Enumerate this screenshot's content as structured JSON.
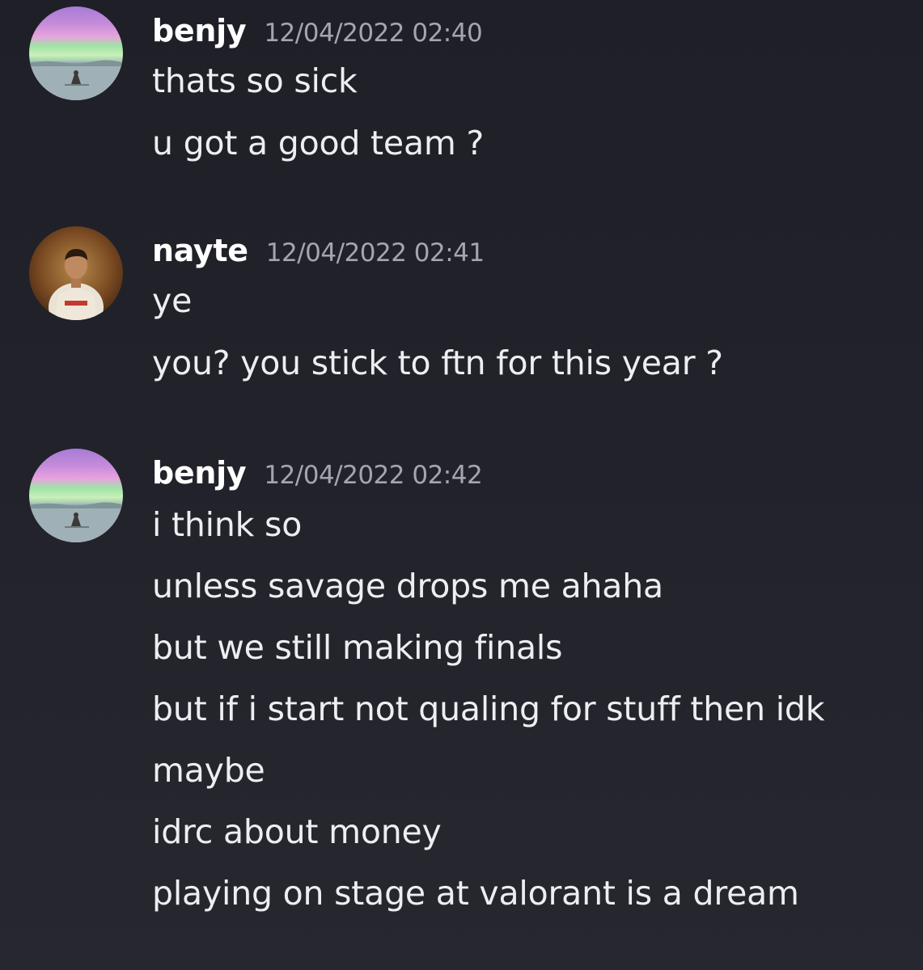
{
  "messages": [
    {
      "username": "benjy",
      "timestamp": "12/04/2022 02:40",
      "avatar_icon": "sunset-sea-avatar-icon",
      "lines": [
        "thats so sick",
        "u got a good team ?"
      ]
    },
    {
      "username": "nayte",
      "timestamp": "12/04/2022 02:41",
      "avatar_icon": "footballer-avatar-icon",
      "lines": [
        "ye",
        "you? you stick to ftn for this year ?"
      ]
    },
    {
      "username": "benjy",
      "timestamp": "12/04/2022 02:42",
      "avatar_icon": "sunset-sea-avatar-icon",
      "lines": [
        "i think so",
        "unless savage drops me ahaha",
        "but we still making finals",
        "but if i start not qualing for stuff then idk",
        "maybe",
        "idrc about money",
        "playing on stage at valorant is a dream"
      ]
    }
  ],
  "colors": {
    "background": "#22222b",
    "username": "#ffffff",
    "timestamp": "#a3a6ad",
    "message_text": "#eceef1"
  }
}
